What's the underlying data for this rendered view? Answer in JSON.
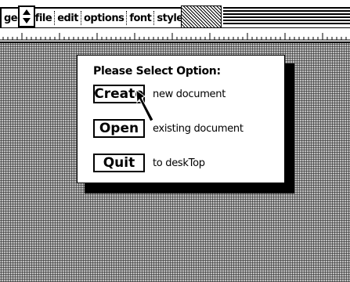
{
  "menubar": {
    "items": [
      "geos",
      "file",
      "edit",
      "options",
      "font",
      "style"
    ]
  },
  "dialog": {
    "title": "Please Select Option:",
    "options": [
      {
        "label": "Create",
        "description": "new document"
      },
      {
        "label": "Open",
        "description": "existing document"
      },
      {
        "label": "Quit",
        "description": "to deskTop"
      }
    ]
  },
  "icons": {
    "scroll": "up-down-arrow-icon",
    "cursor": "pointer-arrow-icon"
  },
  "colors": {
    "foreground": "#000000",
    "background": "#ffffff",
    "desktop": "#8a8a8a"
  }
}
